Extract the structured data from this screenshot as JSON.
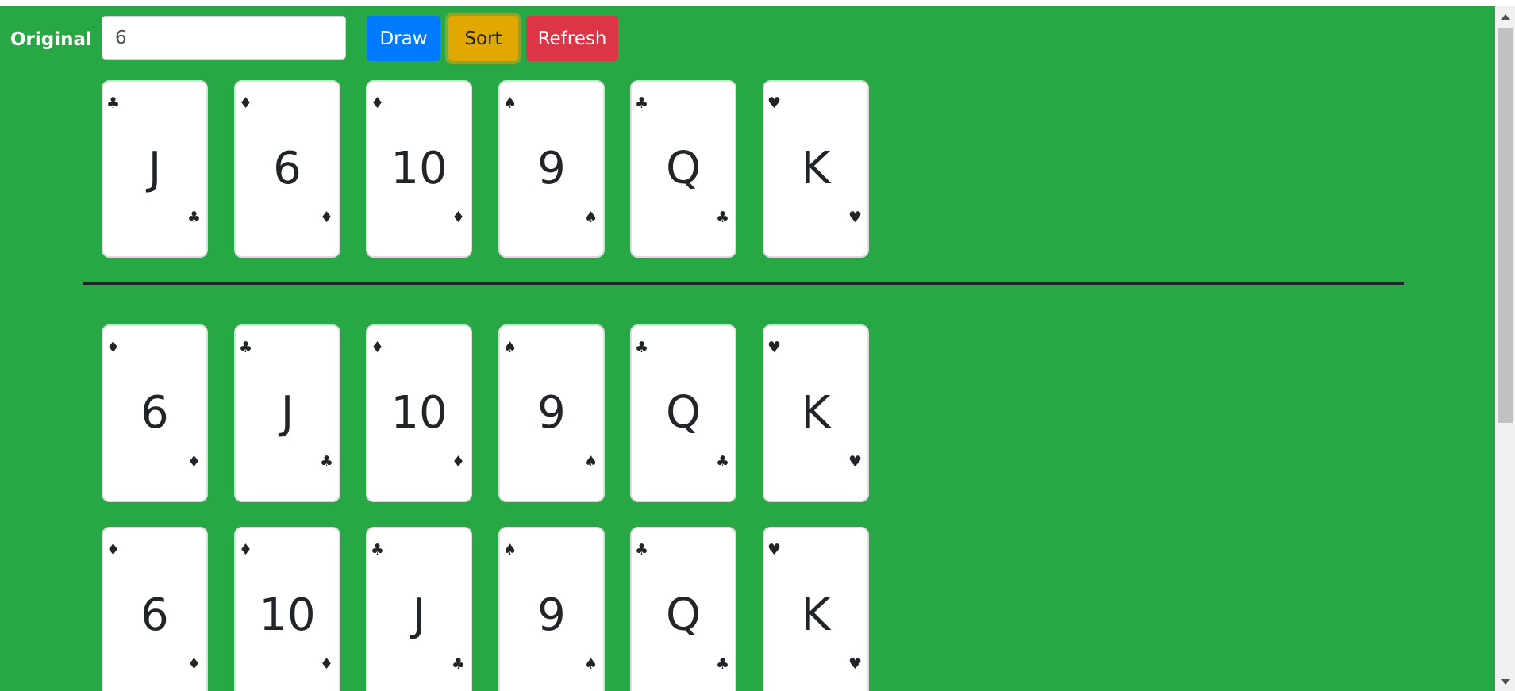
{
  "toolbar": {
    "label": "Original",
    "input_value": "6",
    "draw_label": "Draw",
    "sort_label": "Sort",
    "refresh_label": "Refresh"
  },
  "rows": [
    {
      "cards": [
        {
          "rank": "J",
          "suit": "♣"
        },
        {
          "rank": "6",
          "suit": "♦"
        },
        {
          "rank": "10",
          "suit": "♦"
        },
        {
          "rank": "9",
          "suit": "♠"
        },
        {
          "rank": "Q",
          "suit": "♣"
        },
        {
          "rank": "K",
          "suit": "♥"
        }
      ]
    },
    {
      "cards": [
        {
          "rank": "6",
          "suit": "♦"
        },
        {
          "rank": "J",
          "suit": "♣"
        },
        {
          "rank": "10",
          "suit": "♦"
        },
        {
          "rank": "9",
          "suit": "♠"
        },
        {
          "rank": "Q",
          "suit": "♣"
        },
        {
          "rank": "K",
          "suit": "♥"
        }
      ]
    },
    {
      "cards": [
        {
          "rank": "6",
          "suit": "♦"
        },
        {
          "rank": "10",
          "suit": "♦"
        },
        {
          "rank": "J",
          "suit": "♣"
        },
        {
          "rank": "9",
          "suit": "♠"
        },
        {
          "rank": "Q",
          "suit": "♣"
        },
        {
          "rank": "K",
          "suit": "♥"
        }
      ]
    }
  ],
  "colors": {
    "background": "#28a745",
    "draw": "#007bff",
    "sort": "#e0a800",
    "refresh": "#dc3545"
  }
}
